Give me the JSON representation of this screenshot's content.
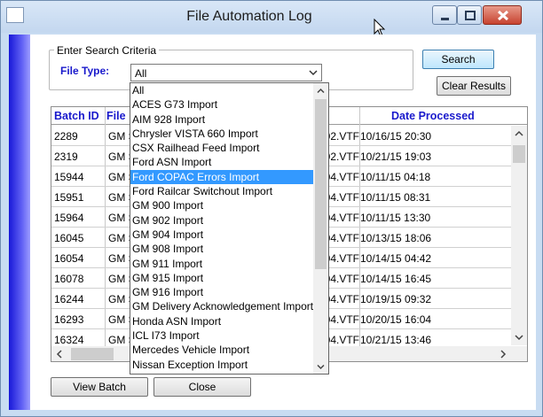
{
  "window": {
    "title": "File Automation Log"
  },
  "search": {
    "legend": "Enter Search Criteria",
    "file_type_label": "File Type:",
    "selected_value": "All",
    "search_label": "Search",
    "clear_label": "Clear Results"
  },
  "grid": {
    "headers": {
      "batch_id": "Batch ID",
      "file": "File",
      "date_processed": "Date Processed"
    },
    "rows": [
      {
        "batch_id": "2289",
        "file": "GM S",
        "path": "L902.VTF",
        "date": "10/16/15 20:30"
      },
      {
        "batch_id": "2319",
        "file": "GM S",
        "path": "L902.VTF",
        "date": "10/21/15 19:03"
      },
      {
        "batch_id": "15944",
        "file": "GM S",
        "path": "L904.VTF",
        "date": "10/11/15 04:18"
      },
      {
        "batch_id": "15951",
        "file": "GM S",
        "path": "L904.VTF",
        "date": "10/11/15 08:31"
      },
      {
        "batch_id": "15964",
        "file": "GM S",
        "path": "L904.VTF",
        "date": "10/11/15 13:30"
      },
      {
        "batch_id": "16045",
        "file": "GM S",
        "path": "L904.VTF",
        "date": "10/13/15 18:06"
      },
      {
        "batch_id": "16054",
        "file": "GM S",
        "path": "L904.VTF",
        "date": "10/14/15 04:42"
      },
      {
        "batch_id": "16078",
        "file": "GM S",
        "path": "L904.VTF",
        "date": "10/14/15 16:45"
      },
      {
        "batch_id": "16244",
        "file": "GM S",
        "path": "L904.VTF",
        "date": "10/19/15 09:32"
      },
      {
        "batch_id": "16293",
        "file": "GM S",
        "path": "L904.VTF",
        "date": "10/20/15 16:04"
      },
      {
        "batch_id": "16324",
        "file": "GM S",
        "path": "L904.VTF",
        "date": "10/21/15 13:46"
      }
    ]
  },
  "dropdown": {
    "items": [
      "All",
      "ACES G73 Import",
      "AIM 928 Import",
      "Chrysler VISTA 660 Import",
      "CSX Railhead Feed Import",
      "Ford ASN Import",
      "Ford COPAC Errors Import",
      "Ford Railcar Switchout Import",
      "GM 900 Import",
      "GM 902 Import",
      "GM 904 Import",
      "GM 908 Import",
      "GM 911 Import",
      "GM 915 Import",
      "GM 916 Import",
      "GM Delivery Acknowledgement Import",
      "Honda ASN Import",
      "ICL I73 Import",
      "Mercedes Vehicle Import",
      "Nissan Exception Import"
    ],
    "highlighted": "Ford COPAC Errors Import"
  },
  "footer": {
    "view_label": "View Batch",
    "close_label": "Close"
  },
  "colors": {
    "header_text": "#1a1acc",
    "highlight": "#3399ff",
    "side_strip": "#1818d8"
  }
}
